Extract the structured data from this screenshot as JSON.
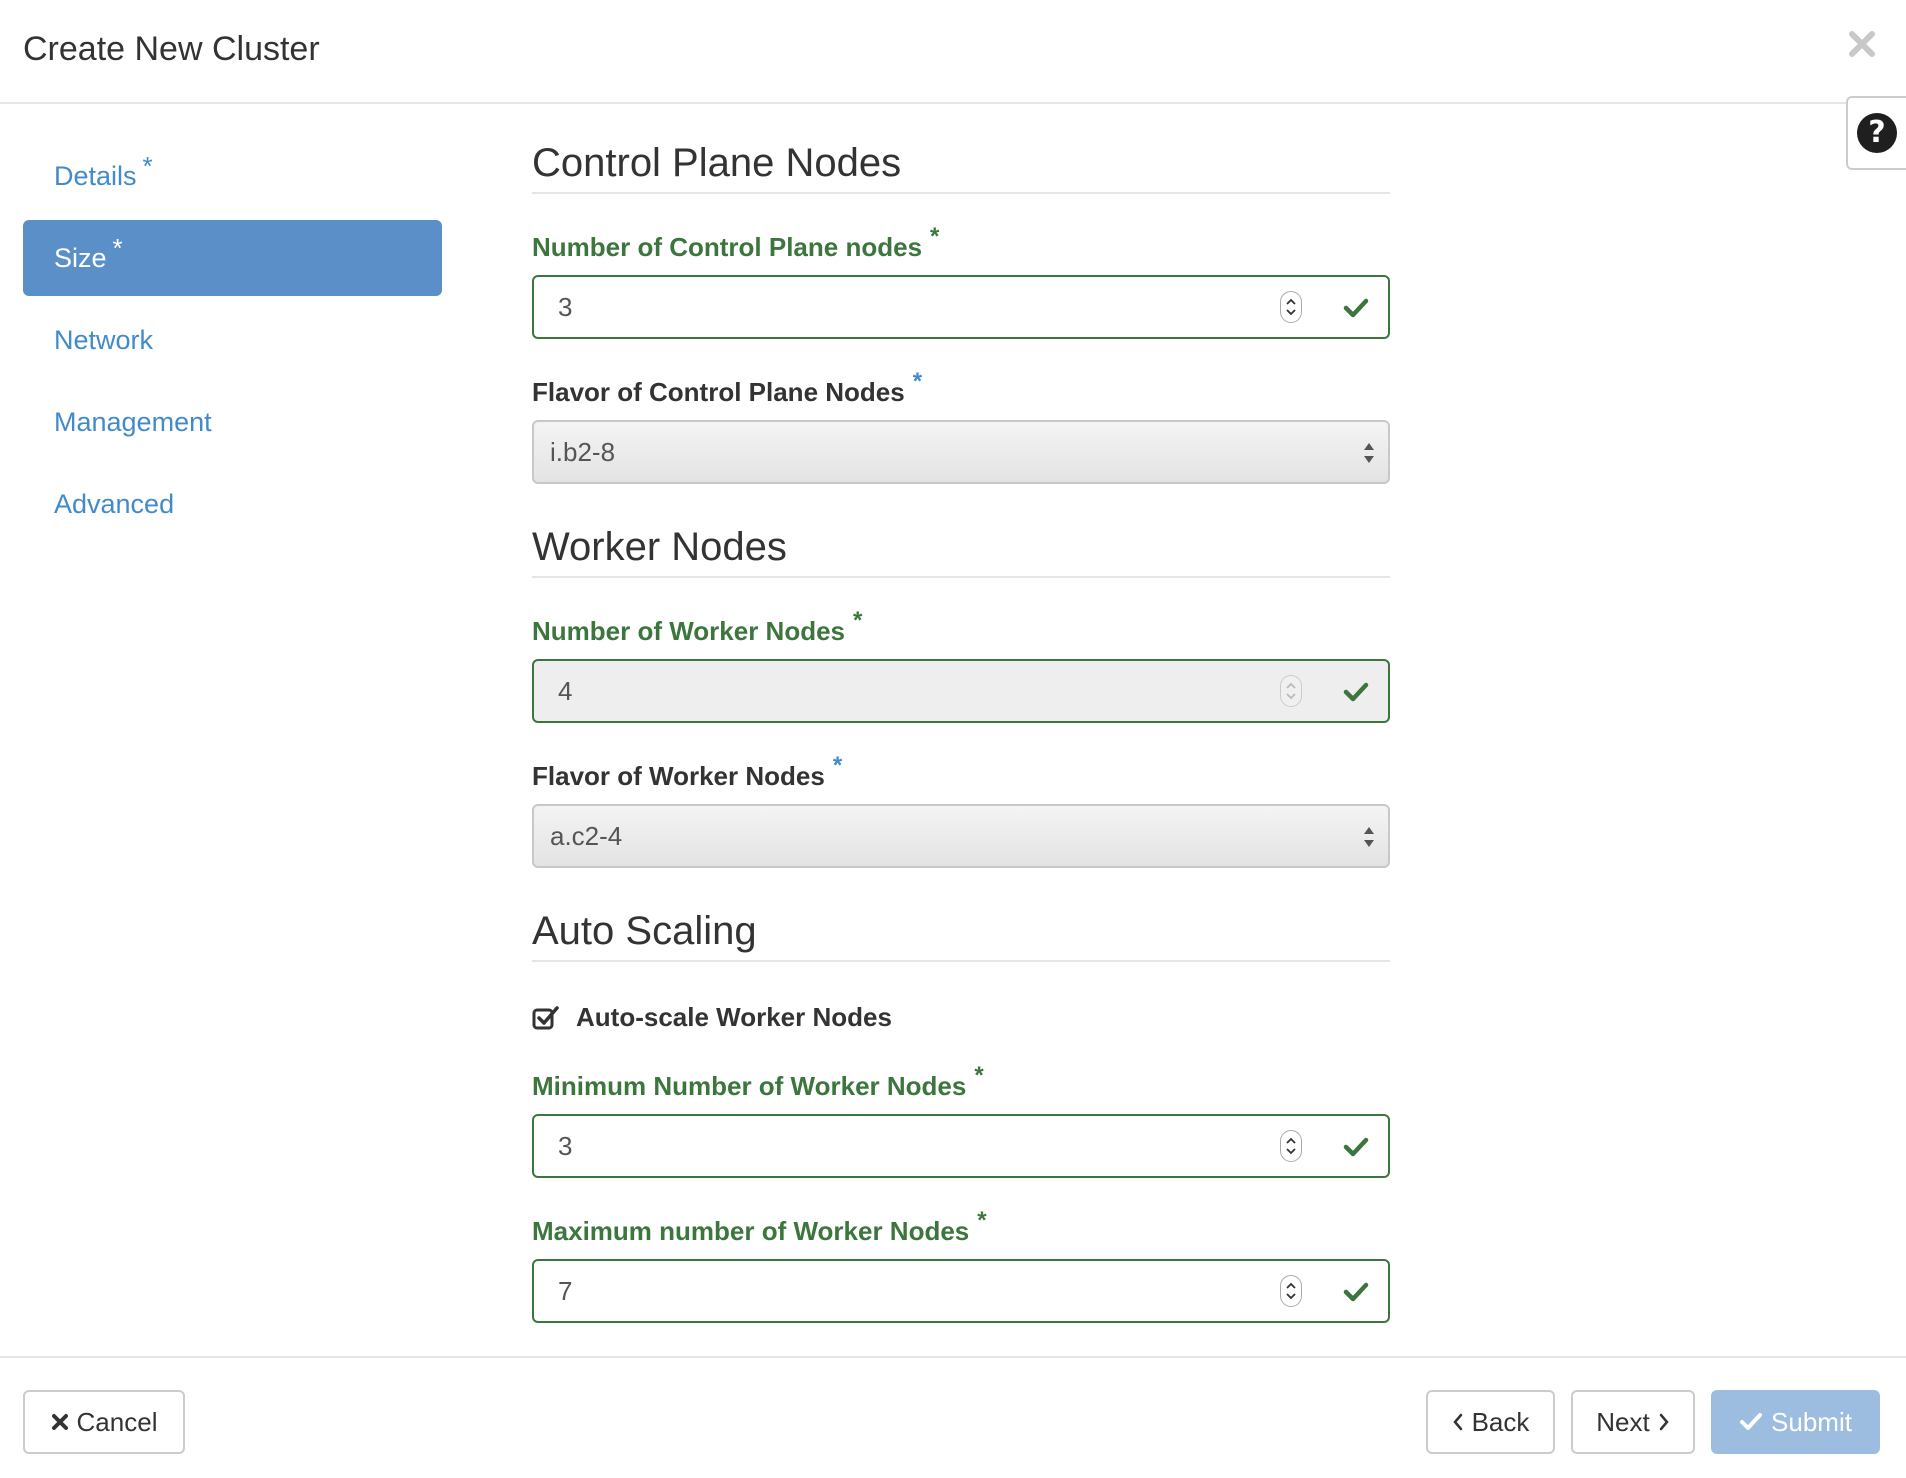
{
  "header": {
    "title": "Create New Cluster"
  },
  "sidebar": {
    "items": [
      {
        "label": "Details",
        "required": "*"
      },
      {
        "label": "Size",
        "required": "*"
      },
      {
        "label": "Network"
      },
      {
        "label": "Management"
      },
      {
        "label": "Advanced"
      }
    ],
    "active_index": 1
  },
  "control_plane": {
    "section_title": "Control Plane Nodes",
    "count_label": "Number of Control Plane nodes",
    "count_value": "3",
    "flavor_label": "Flavor of Control Plane Nodes",
    "flavor_value": "i.b2-8",
    "required_marker": "*"
  },
  "worker": {
    "section_title": "Worker Nodes",
    "count_label": "Number of Worker Nodes",
    "count_value": "4",
    "flavor_label": "Flavor of Worker Nodes",
    "flavor_value": "a.c2-4",
    "required_marker": "*"
  },
  "auto_scaling": {
    "section_title": "Auto Scaling",
    "checkbox_label": "Auto-scale Worker Nodes",
    "checked": true,
    "min_label": "Minimum Number of Worker Nodes",
    "min_value": "3",
    "max_label": "Maximum number of Worker Nodes",
    "max_value": "7",
    "required_marker": "*"
  },
  "footer": {
    "cancel_label": "Cancel",
    "back_label": "Back",
    "next_label": "Next",
    "submit_label": "Submit"
  },
  "colors": {
    "primary": "#428bca",
    "active_nav": "#5a8fc8",
    "valid_green": "#3c763d",
    "submit_disabled": "#9dbde0"
  },
  "icons": {
    "close": "close-icon",
    "help": "help-icon",
    "check": "checkmark-icon",
    "spinner": "number-spinner-icon",
    "select_arrows": "select-arrows-icon",
    "checkbox": "checked-checkbox-icon",
    "cancel": "x-icon",
    "back": "chevron-left-icon",
    "next": "chevron-right-icon",
    "submit": "check-icon"
  }
}
